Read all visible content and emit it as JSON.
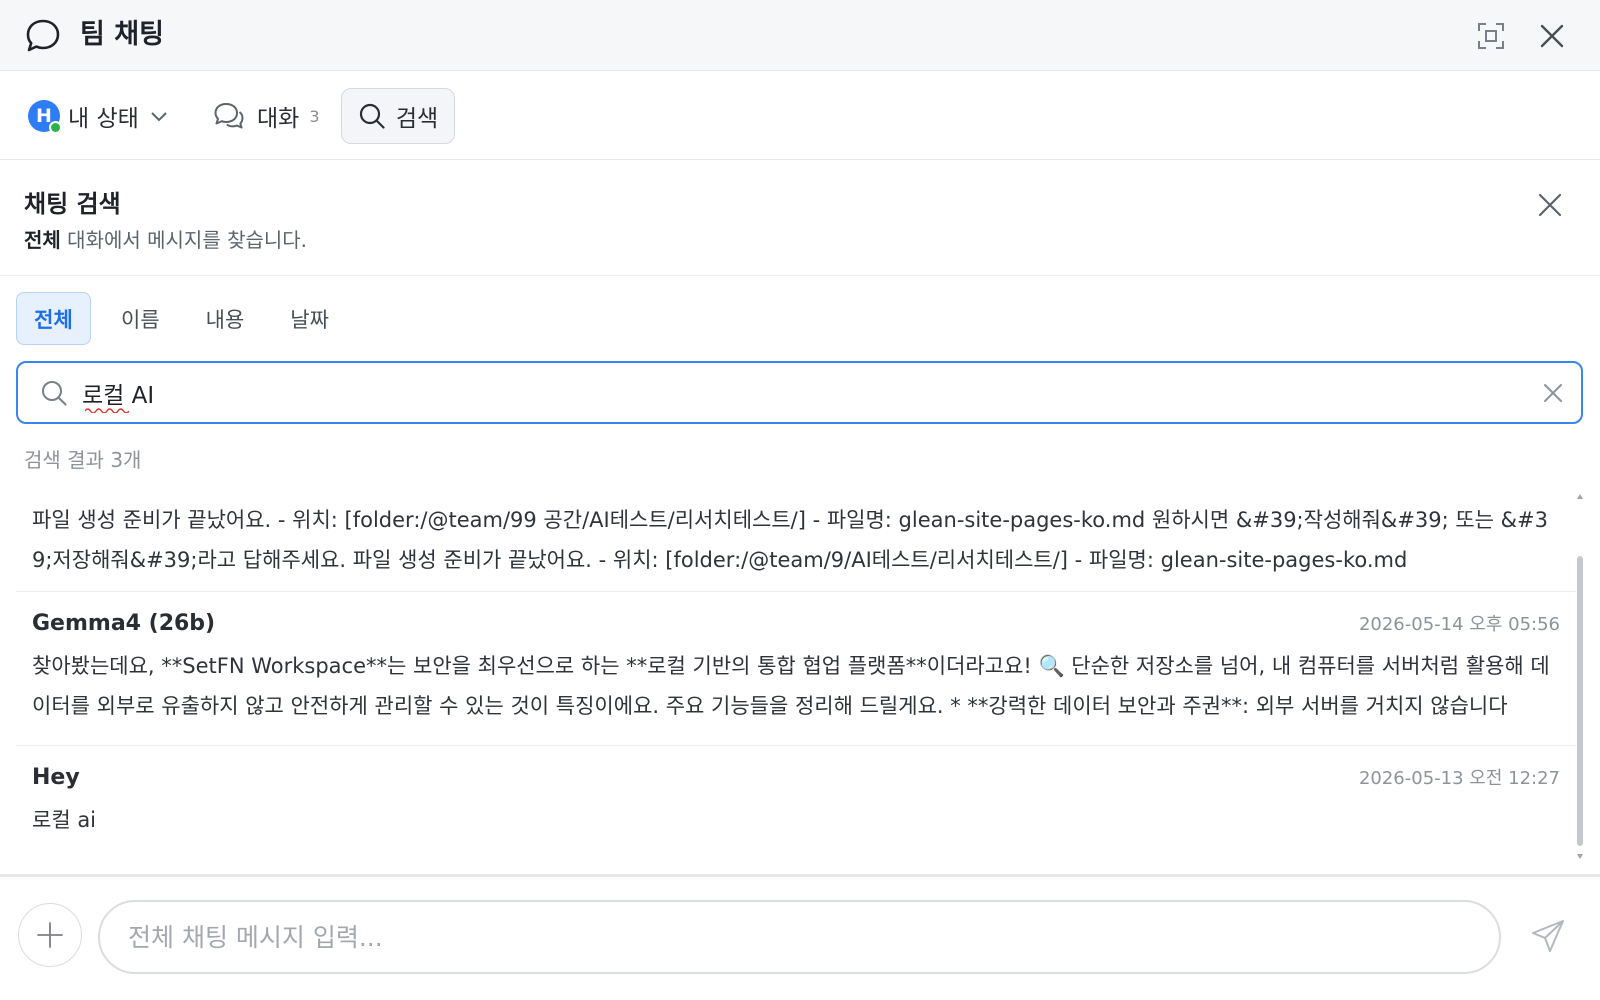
{
  "window": {
    "title": "팀 채팅",
    "title_icon": "chat-bubble-icon",
    "expand_icon": "expand-icon",
    "close_icon": "close-icon"
  },
  "toolbar": {
    "avatar_initial": "H",
    "status_label": "내 상태",
    "conversations_label": "대화",
    "conversations_count": "3",
    "search_label": "검색",
    "accent": "#2e7cf6",
    "online_color": "#28b446"
  },
  "search_panel": {
    "title": "채팅 검색",
    "subtitle_strong": "전체",
    "subtitle_rest": " 대화에서 메시지를 찾습니다.",
    "tabs": [
      {
        "label": "전체",
        "active": true
      },
      {
        "label": "이름",
        "active": false
      },
      {
        "label": "내용",
        "active": false
      },
      {
        "label": "날짜",
        "active": false
      }
    ],
    "query": "로컬 AI",
    "result_count": "검색 결과 3개"
  },
  "results": [
    {
      "name": "",
      "time": "",
      "text": "파일 생성 준비가 끝났어요. - 위치: [folder:/@team/99 공간/AI테스트/리서치테스트/] - 파일명: glean-site-pages-ko.md 원하시면 &#39;작성해줘&#39; 또는 &#39;저장해줘&#39;라고 답해주세요. 파일 생성 준비가 끝났어요. - 위치: [folder:/@team/9/AI테스트/리서치테스트/] - 파일명: glean-site-pages-ko.md"
    },
    {
      "name": "Gemma4 (26b)",
      "time": "2026-05-14  오후 05:56",
      "text": "찾아봤는데요, **SetFN Workspace**는 보안을 최우선으로 하는 **로컬 기반의 통합 협업 플랫폼**이더라고요! 🔍 단순한 저장소를 넘어, 내 컴퓨터를 서버처럼 활용해 데이터를 외부로 유출하지 않고 안전하게 관리할 수 있는 것이 특징이에요. 주요 기능들을 정리해 드릴게요. * **강력한 데이터 보안과 주권**: 외부 서버를 거치지 않습니다"
    },
    {
      "name": "Hey",
      "time": "2026-05-13  오전 12:27",
      "text": "로컬 ai"
    }
  ],
  "composer": {
    "placeholder": "전체 채팅 메시지 입력...",
    "add_icon": "plus-icon",
    "send_icon": "send-icon"
  }
}
